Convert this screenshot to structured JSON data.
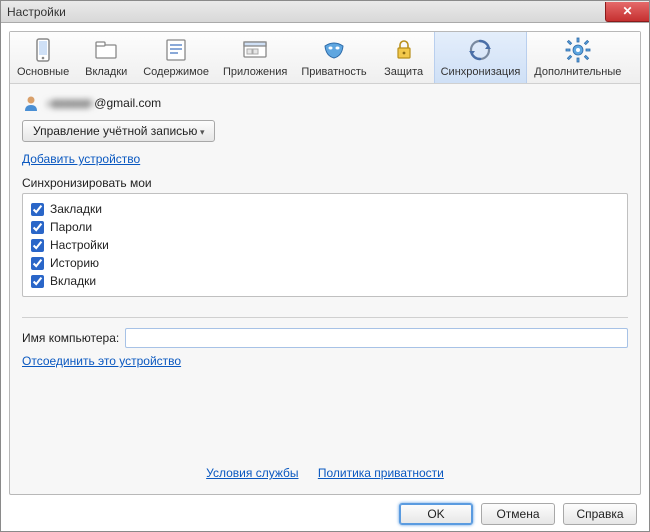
{
  "window_title": "Настройки",
  "close_label": "✕",
  "tabs": [
    {
      "label": "Основные",
      "icon": "device-icon"
    },
    {
      "label": "Вкладки",
      "icon": "folder-icon"
    },
    {
      "label": "Содержимое",
      "icon": "content-icon"
    },
    {
      "label": "Приложения",
      "icon": "apps-icon"
    },
    {
      "label": "Приватность",
      "icon": "mask-icon"
    },
    {
      "label": "Защита",
      "icon": "lock-icon"
    },
    {
      "label": "Синхронизация",
      "icon": "sync-icon",
      "active": true
    },
    {
      "label": "Дополнительные",
      "icon": "gear-icon"
    }
  ],
  "user": {
    "masked_local": "a▮▮▮▮▮▮k",
    "domain": "@gmail.com"
  },
  "manage_account_label": "Управление учётной записью",
  "add_device_link": "Добавить устройство",
  "sync_my_label": "Синхронизировать мои",
  "sync_items": [
    {
      "label": "Закладки",
      "checked": true
    },
    {
      "label": "Пароли",
      "checked": true
    },
    {
      "label": "Настройки",
      "checked": true
    },
    {
      "label": "Историю",
      "checked": true
    },
    {
      "label": "Вкладки",
      "checked": true
    }
  ],
  "computer_name_label": "Имя компьютера:",
  "computer_name_value": "",
  "disconnect_link": "Отсоединить это устройство",
  "tos_link": "Условия службы",
  "privacy_link": "Политика приватности",
  "footer": {
    "ok": "OK",
    "cancel": "Отмена",
    "help": "Справка"
  }
}
